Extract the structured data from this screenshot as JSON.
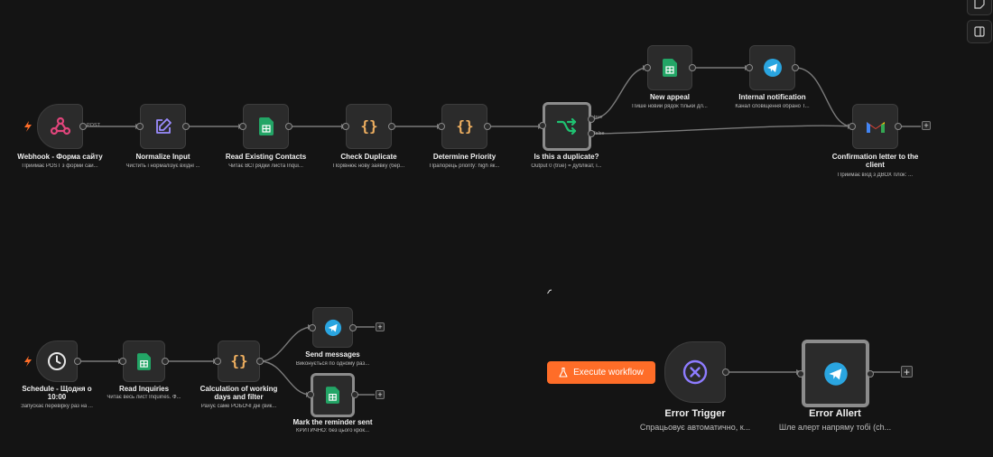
{
  "nodes": {
    "webhook": {
      "title": "Webhook - Форма сайту",
      "sub": "Приймає POST з форми сай..."
    },
    "normalize": {
      "title": "Normalize Input",
      "sub": "Чистить і нормалізує вхідні ..."
    },
    "read_contacts": {
      "title": "Read Existing Contacts",
      "sub": "Читає ВСІ рядки листа Inqui..."
    },
    "check_duplicate": {
      "title": "Check Duplicate",
      "sub": "Порівнює нову заявку (бер..."
    },
    "determine_priority": {
      "title": "Determine Priority",
      "sub": "Прапорець priority: high як..."
    },
    "is_duplicate": {
      "title": "Is this a duplicate?",
      "sub": "Output 0 (true) = дублікат, і..."
    },
    "new_appeal": {
      "title": "New appeal",
      "sub": "Пише новий рядок тільки дл..."
    },
    "internal_notification": {
      "title": "Internal notification",
      "sub": "Канал сповіщення обрано Т..."
    },
    "confirmation_letter": {
      "title_1": "Confirmation letter to the",
      "title_2": "client",
      "sub": "Приймає вхід з ДВОХ гілок: ..."
    },
    "schedule": {
      "title_1": "Schedule - Щодня о",
      "title_2": "10:00",
      "sub": "Запускає перевірку раз на ..."
    },
    "read_inquiries": {
      "title": "Read Inquiries",
      "sub": "Читає весь лист Inquiries. Ф..."
    },
    "calc_working_days": {
      "title_1": "Calculation of working",
      "title_2": "days and filter",
      "sub": "Рахує саме РОБОЧІ дні (вик..."
    },
    "send_messages": {
      "title": "Send messages",
      "sub": "Виконується по одному раз..."
    },
    "mark_reminder": {
      "title": "Mark the reminder sent",
      "sub": "КРИТИЧНО: без цього крок..."
    },
    "error_trigger": {
      "title": "Error Trigger",
      "sub": "Спрацьовує автоматично, к..."
    },
    "error_alert": {
      "title": "Error Allert",
      "sub": "Шле алерт напряму тобі (ch..."
    }
  },
  "edge_labels": {
    "post": "POST",
    "true": "true",
    "false": "false"
  },
  "execute_button": {
    "label": "Execute workflow",
    "icon": "flask-icon"
  },
  "plus_symbol": "+",
  "colors": {
    "canvas": "#141414",
    "node_bg": "#2b2b2b",
    "webhook": "#e0457b",
    "normalize": "#9b8cff",
    "sheets": "#23a566",
    "code_braces": "#f0b060",
    "switch": "#1fc271",
    "telegram": "#2aa5e0",
    "error": "#8e7cff",
    "execute_button": "#ff6d28"
  }
}
